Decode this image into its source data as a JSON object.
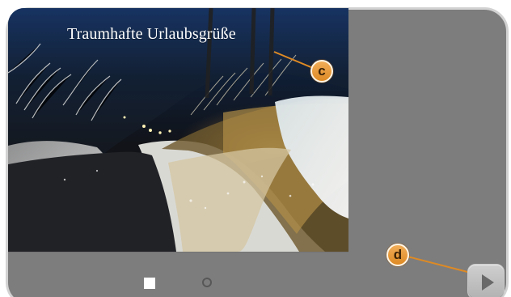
{
  "caption": {
    "text": "Traumhafte Urlaubsgrüße"
  },
  "callouts": {
    "c": "c",
    "d": "d"
  },
  "pagination": {
    "active_icon": "square-indicator",
    "inactive_icon": "circle-indicator"
  },
  "controls": {
    "next_icon": "play-icon"
  },
  "colors": {
    "panel": "#7d7d7d",
    "frame_outline": "#d2d2d2",
    "callout": "#de8a24",
    "caption": "#ffffff"
  }
}
